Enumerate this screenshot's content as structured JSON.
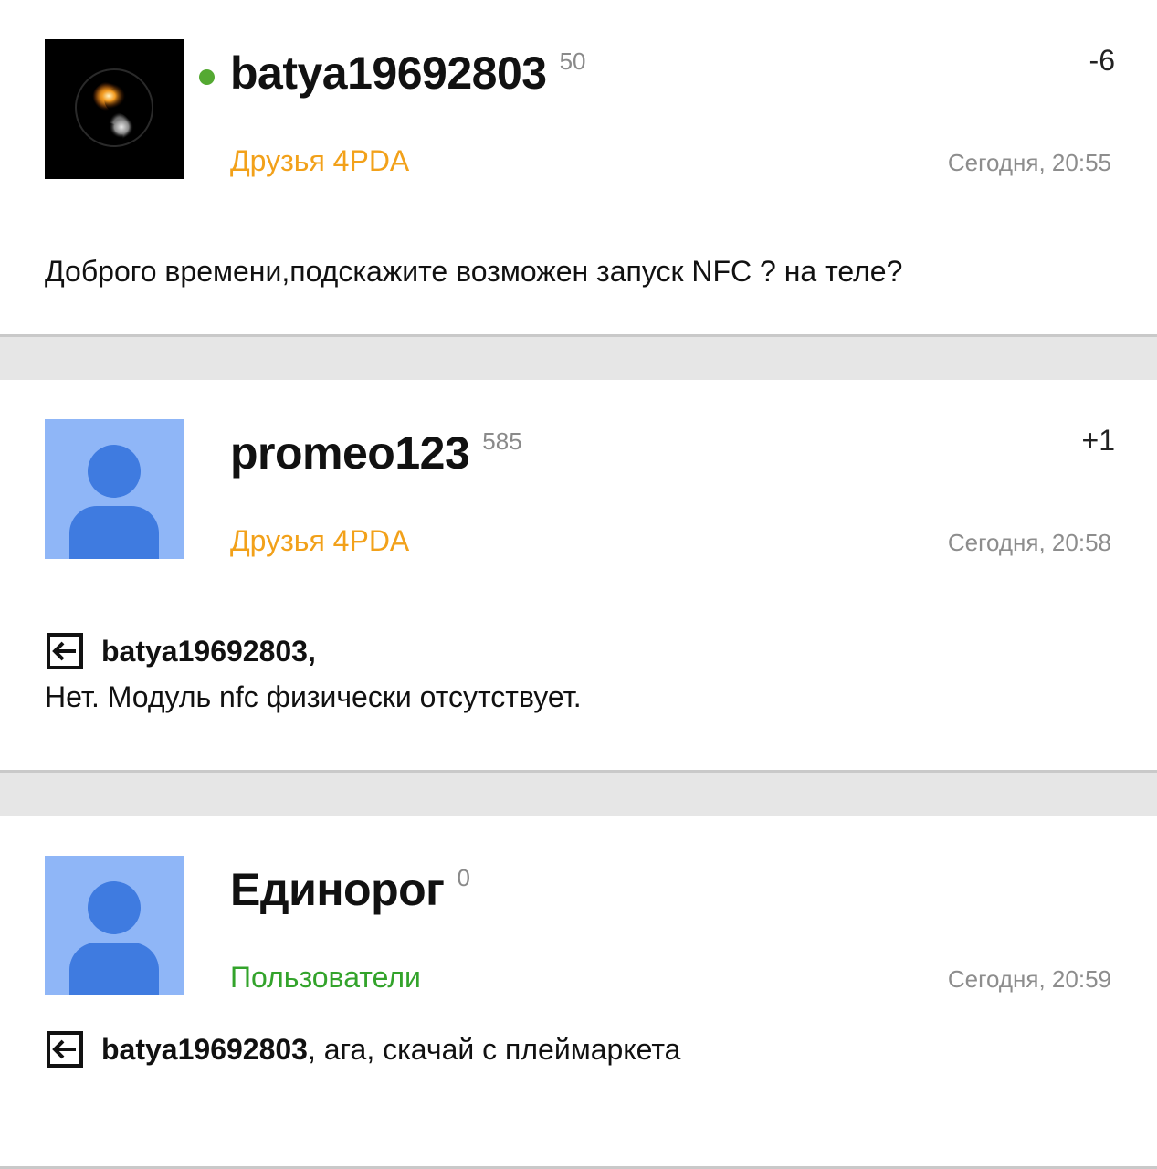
{
  "posts": [
    {
      "username": "batya19692803",
      "reputation": "50",
      "karma": "-6",
      "group": "Друзья 4PDA",
      "date": "Сегодня, 20:55",
      "online": true,
      "avatar": "flame-avatar",
      "text": "Доброго времени,подскажите возможен запуск NFC ? на теле?"
    },
    {
      "username": "promeo123",
      "reputation": "585",
      "karma": "+1",
      "group": "Друзья 4PDA",
      "date": "Сегодня, 20:58",
      "avatar": "default-user-avatar",
      "reply_to": "batya19692803,",
      "text": "Нет. Модуль nfc физически отсутствует."
    },
    {
      "username": "Единорог",
      "reputation": "0",
      "group": "Пользователи",
      "date": "Сегодня, 20:59",
      "avatar": "default-user-avatar",
      "reply_to": "batya19692803",
      "text": ", ага, скачай с плеймаркета"
    }
  ],
  "colors": {
    "friends_group": "#f2a11a",
    "users_group": "#33a32b",
    "online": "#54a932",
    "avatar_bg": "#8fb6f7",
    "avatar_fg": "#3f7be0"
  },
  "icons": {
    "quote": "reply-arrow-icon"
  }
}
